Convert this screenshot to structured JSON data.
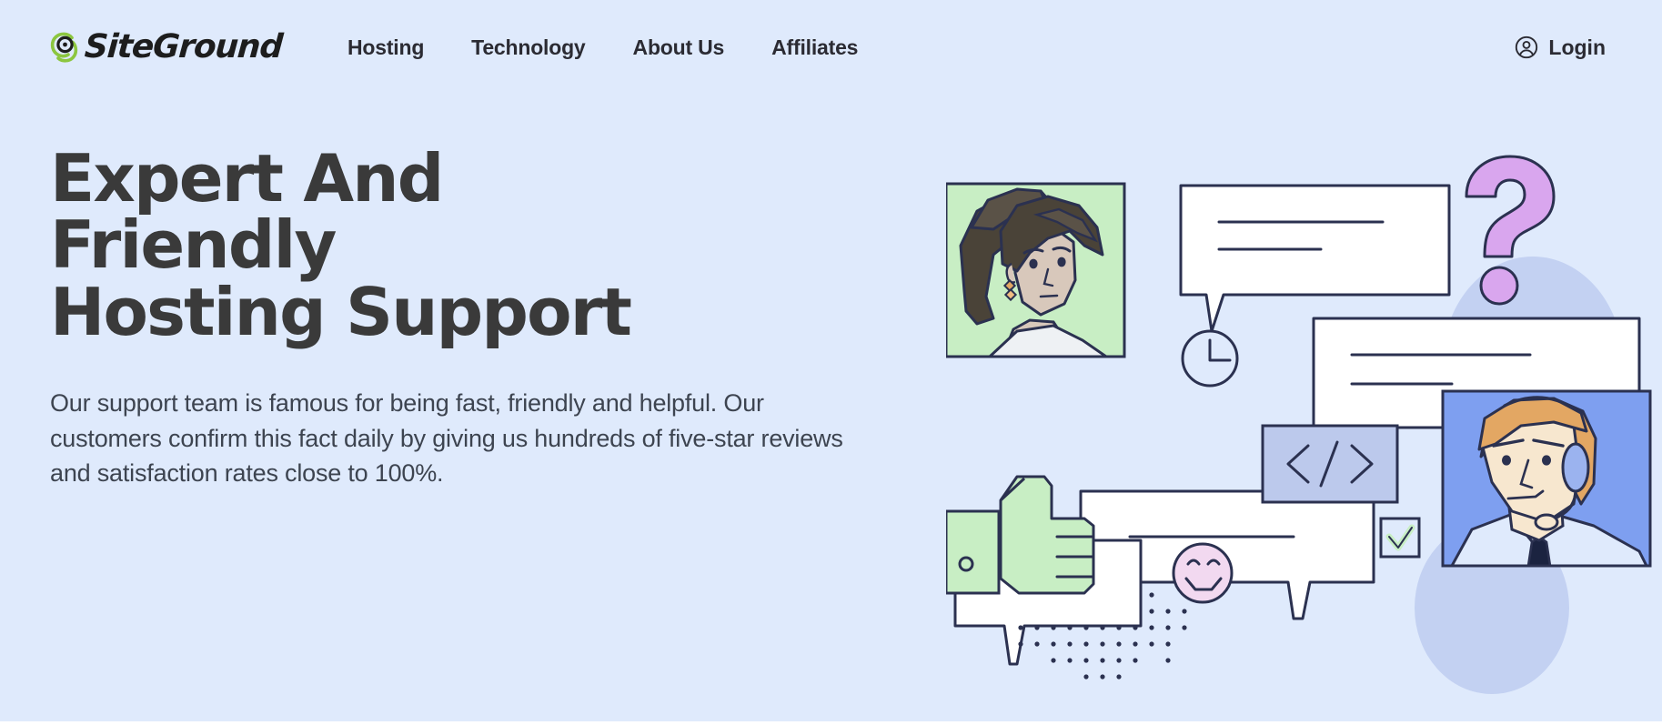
{
  "page": {
    "background_color": "#dfeafc",
    "text_color": "#3a3a3a"
  },
  "header": {
    "brand": {
      "name": "SiteGround",
      "logo_icon": "siteground-swirl-icon",
      "logo_accent_color": "#8cc63f"
    },
    "nav_items": [
      {
        "label": "Hosting"
      },
      {
        "label": "Technology"
      },
      {
        "label": "About Us"
      },
      {
        "label": "Affiliates"
      }
    ],
    "login": {
      "label": "Login",
      "icon": "user-circle-icon"
    }
  },
  "hero": {
    "title_line_1": "Expert And Friendly",
    "title_line_2": "Hosting Support",
    "title": "Expert And Friendly Hosting Support",
    "paragraph": "Our support team is famous for being fast, friendly and helpful. Our customers confirm this fact daily by giving us hundreds of five-star reviews and satisfaction rates close to 100%."
  },
  "illustration": {
    "alt": "Customer support illustration with chat bubbles, agents, thumbs up, smiley and code icons",
    "colors": {
      "outline": "#2b3150",
      "bubble_fill": "#ffffff",
      "accent_green": "#c8eec4",
      "accent_purple": "#d9a6ee",
      "accent_pink": "#f2d9f0",
      "accent_periwinkle": "#bcc9ec",
      "blob": "#c3d1f2",
      "agent_bg": "#7e9ff0",
      "portrait_bg": "#c8eec4",
      "skin": "#f7e7cf",
      "hair_orange": "#e3a763",
      "hair_brown": "#4a4338",
      "shirt": "#dfeafc"
    },
    "elements": [
      {
        "name": "woman-portrait",
        "label": "Woman support representative portrait"
      },
      {
        "name": "chat-bubble-top",
        "label": "Chat message bubble"
      },
      {
        "name": "chat-bubble-right",
        "label": "Chat message bubble"
      },
      {
        "name": "chat-bubble-middle",
        "label": "Chat message bubble"
      },
      {
        "name": "chat-bubble-bottom-left",
        "label": "Chat message bubble"
      },
      {
        "name": "question-mark",
        "label": "Question mark"
      },
      {
        "name": "clock-icon",
        "label": "Clock showing response time"
      },
      {
        "name": "code-tag-badge",
        "label": "Code tag badge",
        "text": "</>"
      },
      {
        "name": "thumbs-up-icon",
        "label": "Thumbs up"
      },
      {
        "name": "smiley-face-icon",
        "label": "Smiling face"
      },
      {
        "name": "checkbox-check-icon",
        "label": "Checked checkbox"
      },
      {
        "name": "dot-grid-pattern",
        "label": "Decorative dot grid"
      },
      {
        "name": "agent-portrait",
        "label": "Male support agent with headset portrait"
      }
    ]
  }
}
